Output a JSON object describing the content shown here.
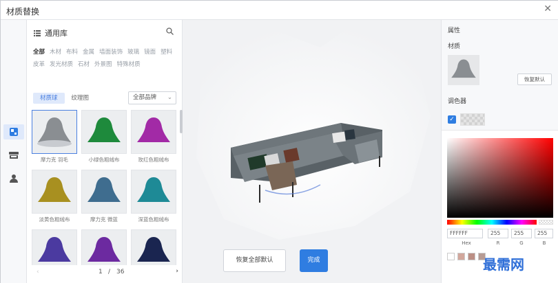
{
  "window": {
    "title": "材质替换",
    "close": "✕"
  },
  "rail": {
    "icons": [
      "material-icon",
      "furniture-icon",
      "user-icon"
    ]
  },
  "library": {
    "name": "通用库",
    "categories": [
      {
        "label": "全部",
        "active": true
      },
      {
        "label": "木材"
      },
      {
        "label": "布料"
      },
      {
        "label": "金属"
      },
      {
        "label": "墙面装饰"
      },
      {
        "label": "玻璃"
      },
      {
        "label": "镜面"
      },
      {
        "label": "塑料"
      },
      {
        "label": "皮革"
      },
      {
        "label": "发光材质"
      },
      {
        "label": "石材"
      },
      {
        "label": "外景图"
      },
      {
        "label": "特殊材质"
      }
    ],
    "tabs": [
      {
        "label": "材质球",
        "active": true
      },
      {
        "label": "纹理图"
      }
    ],
    "brand_select": "全部品牌",
    "tiles": [
      {
        "label": "摩力克 羽毛",
        "color": "#8a8e92",
        "selected": true
      },
      {
        "label": "小绿色粗绒布",
        "color": "#1e8a3c"
      },
      {
        "label": "玫红色粗绒布",
        "color": "#a22aa6"
      },
      {
        "label": "淡黄色粗绒布",
        "color": "#a89020"
      },
      {
        "label": "摩力克 微蓝",
        "color": "#3f6d8f"
      },
      {
        "label": "深蓝色粗绒布",
        "color": "#1e8a96"
      },
      {
        "label": "",
        "color": "#4b3aa0"
      },
      {
        "label": "",
        "color": "#6c2aa0"
      },
      {
        "label": "",
        "color": "#1a2550"
      }
    ],
    "pager": {
      "current": "1",
      "slash": "/",
      "total": "36",
      "prev": "‹",
      "next": "›"
    }
  },
  "canvas": {
    "reset_label": "恢复全部默认",
    "done_label": "完成"
  },
  "properties": {
    "heading": "属性",
    "material_label": "材质",
    "restore_label": "恢复默认",
    "palette_label": "调色器",
    "checkbox": "✓",
    "picker": {
      "hex": "FFFFFF",
      "r": "255",
      "g": "255",
      "b": "255",
      "hex_label": "Hex",
      "r_label": "R",
      "g_label": "G",
      "b_label": "B",
      "presets": [
        "#ffffff",
        "#d2a79c",
        "#bc8f85",
        "#b79b94"
      ]
    }
  },
  "watermark": "最需网"
}
